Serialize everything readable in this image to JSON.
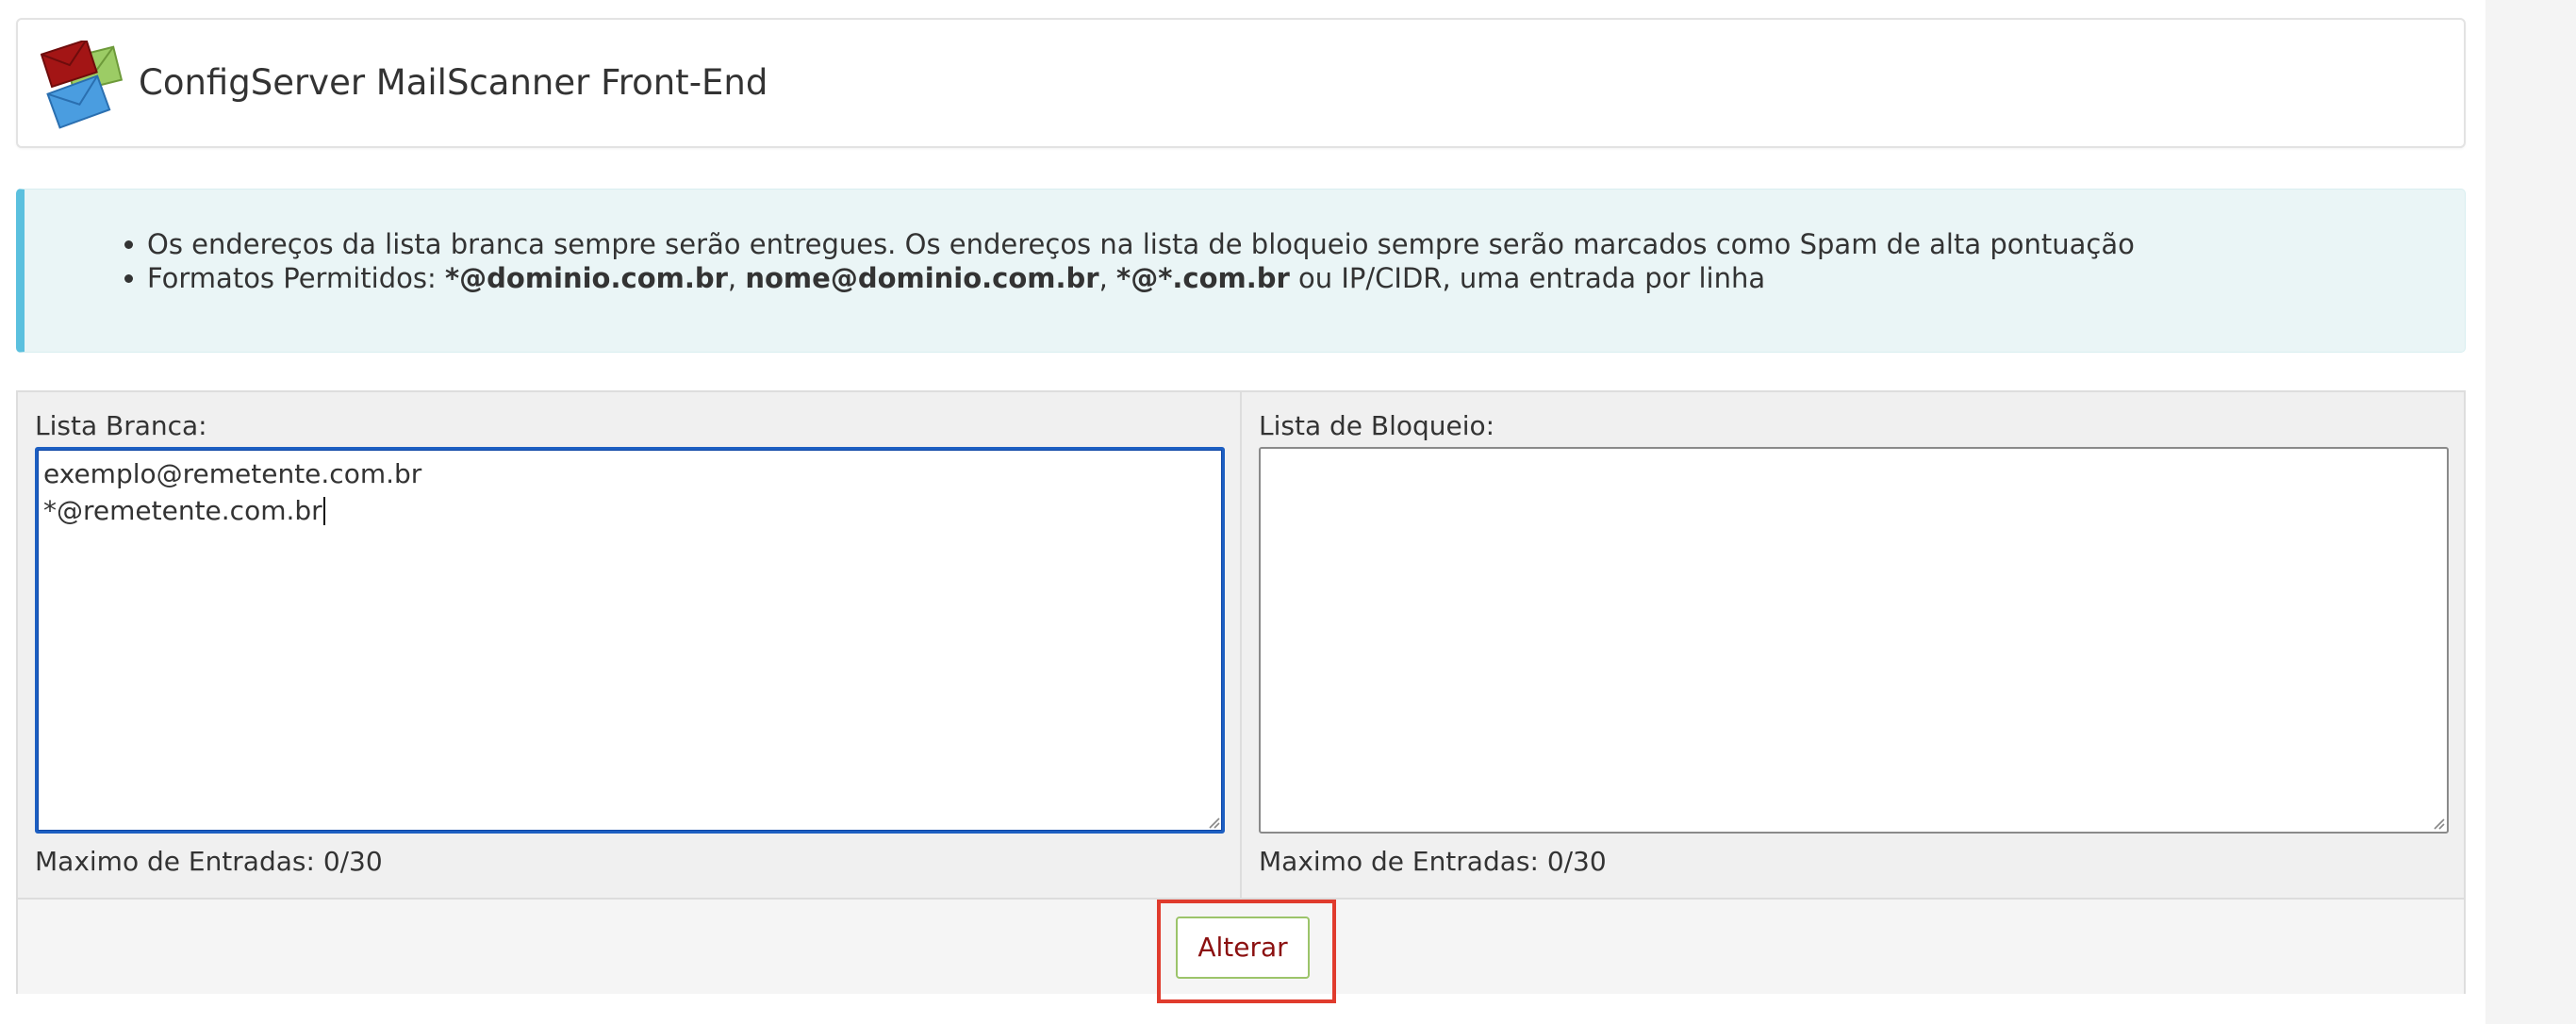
{
  "header": {
    "title": "ConfigServer MailScanner Front-End"
  },
  "info": {
    "line1": "Os endereços da lista branca sempre serão entregues. Os endereços na lista de bloqueio sempre serão marcados como Spam de alta pontuação",
    "line2_prefix": "Formatos Permitidos: ",
    "format1": "*@dominio.com.br",
    "sep1": ", ",
    "format2": "nome@dominio.com.br",
    "sep2": ", ",
    "format3": "*@*.com.br",
    "line2_suffix": " ou IP/CIDR, uma entrada por linha"
  },
  "whitelist": {
    "label": "Lista Branca:",
    "value": "exemplo@remetente.com.br\n*@remetente.com.br",
    "footer": "Maximo de Entradas: 0/30"
  },
  "blocklist": {
    "label": "Lista de Bloqueio:",
    "value": "",
    "footer": "Maximo de Entradas: 0/30"
  },
  "actions": {
    "submit_label": "Alterar"
  },
  "colors": {
    "accent_border": "#5bc0de",
    "button_text": "#8b1010",
    "highlight": "#e03b2d",
    "focus": "#1d5fc2"
  },
  "icons": {
    "logo": "mail-envelopes-icon"
  }
}
